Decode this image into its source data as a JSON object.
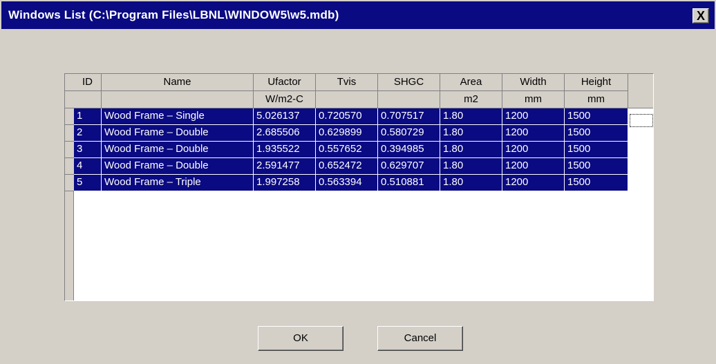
{
  "window": {
    "title": "Windows List (C:\\Program Files\\LBNL\\WINDOW5\\w5.mdb)",
    "close_label": "X"
  },
  "table": {
    "columns": [
      {
        "label": "ID",
        "unit": ""
      },
      {
        "label": "Name",
        "unit": ""
      },
      {
        "label": "Ufactor",
        "unit": "W/m2-C"
      },
      {
        "label": "Tvis",
        "unit": ""
      },
      {
        "label": "SHGC",
        "unit": ""
      },
      {
        "label": "Area",
        "unit": "m2"
      },
      {
        "label": "Width",
        "unit": "mm"
      },
      {
        "label": "Height",
        "unit": "mm"
      }
    ],
    "rows": [
      [
        "1",
        "Wood Frame – Single",
        "5.026137",
        "0.720570",
        "0.707517",
        "1.80",
        "1200",
        "1500"
      ],
      [
        "2",
        "Wood Frame – Double",
        "2.685506",
        "0.629899",
        "0.580729",
        "1.80",
        "1200",
        "1500"
      ],
      [
        "3",
        "Wood Frame – Double",
        "1.935522",
        "0.557652",
        "0.394985",
        "1.80",
        "1200",
        "1500"
      ],
      [
        "4",
        "Wood Frame – Double",
        "2.591477",
        "0.652472",
        "0.629707",
        "1.80",
        "1200",
        "1500"
      ],
      [
        "5",
        "Wood Frame – Triple",
        "1.997258",
        "0.563394",
        "0.510881",
        "1.80",
        "1200",
        "1500"
      ]
    ],
    "selection_color": "#0a0a82"
  },
  "buttons": {
    "ok": "OK",
    "cancel": "Cancel"
  }
}
